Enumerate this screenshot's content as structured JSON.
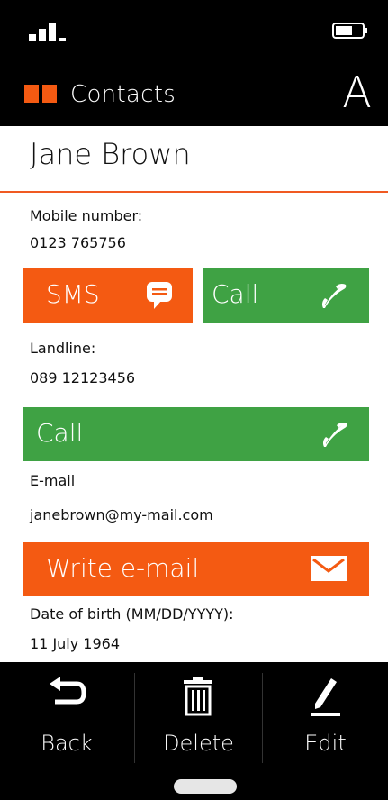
{
  "status": {
    "signal_icon": "signal-icon",
    "battery_icon": "battery-icon"
  },
  "header": {
    "title": "Contacts",
    "index_letter": "A",
    "icon": "book-icon"
  },
  "contact": {
    "name": "Jane Brown",
    "mobile_label": "Mobile number:",
    "mobile_value": "0123 765756",
    "landline_label": "Landline:",
    "landline_value": "089 12123456",
    "email_label": "E-mail",
    "email_value": "janebrown@my-mail.com",
    "dob_label": "Date of birth (MM/DD/YYYY):",
    "dob_value": "11 July 1964"
  },
  "buttons": {
    "sms": "SMS",
    "call_mobile": "Call",
    "call_landline": "Call",
    "write_email": "Write e-mail"
  },
  "footer": {
    "back": "Back",
    "delete": "Delete",
    "edit": "Edit"
  },
  "colors": {
    "orange": "#f45a12",
    "green": "#3fa244",
    "divider": "#f05a22"
  }
}
